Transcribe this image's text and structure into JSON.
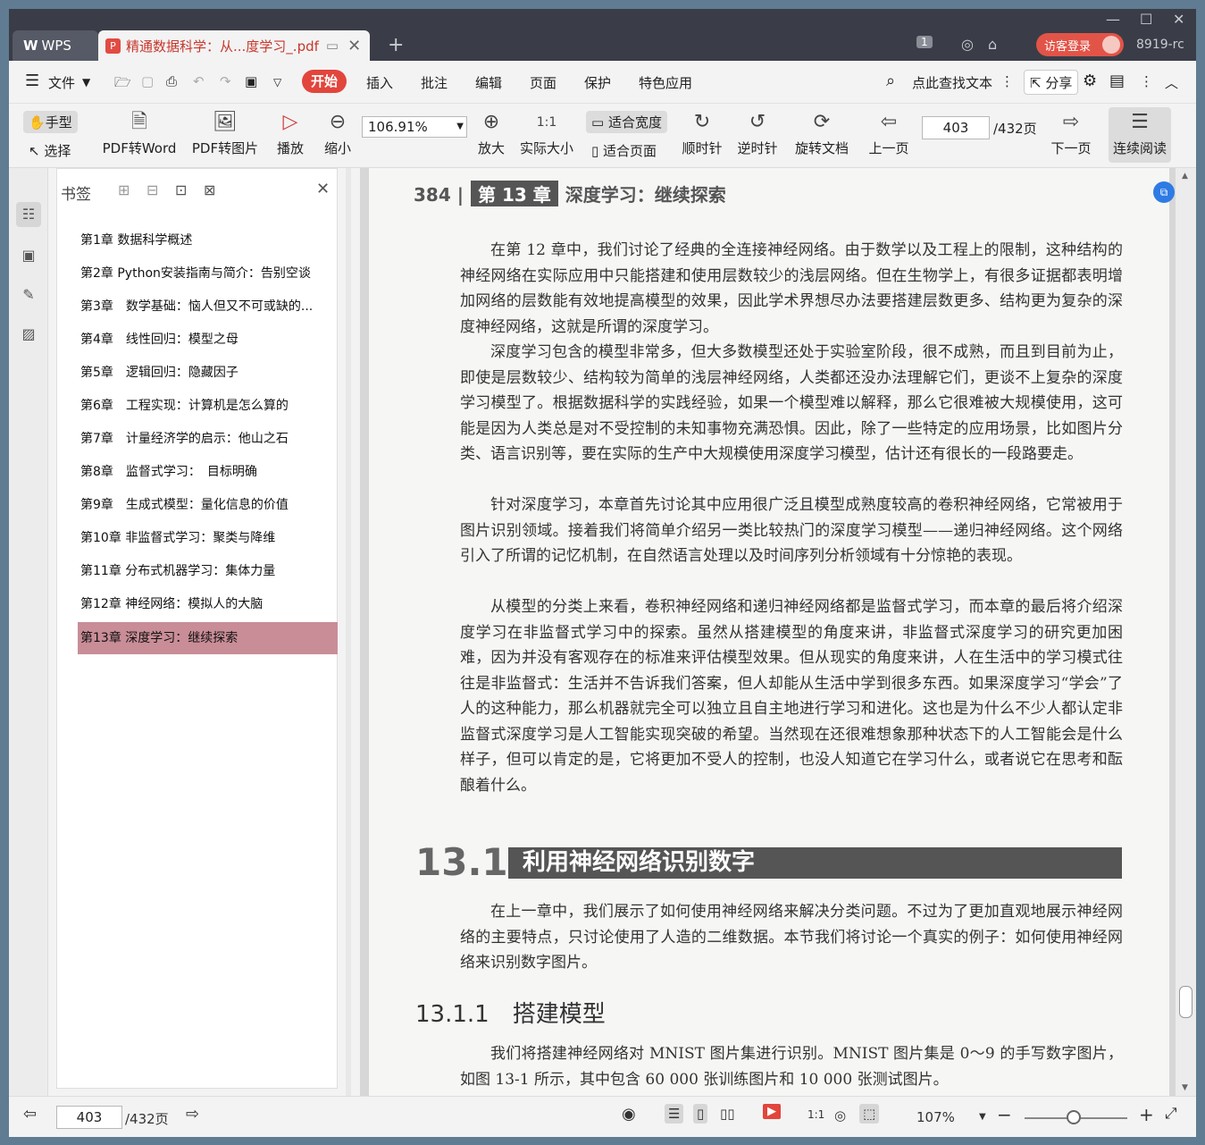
{
  "titlebar": {
    "app": "WPS",
    "doc_tab": "精通数据科学：从...度学习_.pdf",
    "tab_count": "1",
    "login": "访客登录",
    "version": "8919-rc"
  },
  "menu": {
    "file": "文件",
    "items": [
      "开始",
      "插入",
      "批注",
      "编辑",
      "页面",
      "保护",
      "特色应用"
    ],
    "search": "点此查找文本",
    "share": "分享"
  },
  "ribbon": {
    "hand": "手型",
    "select": "选择",
    "pdf_word": "PDF转Word",
    "pdf_image": "PDF转图片",
    "play": "播放",
    "zoom_out": "缩小",
    "zoom": "106.91%",
    "zoom_in": "放大",
    "actual": "实际大小",
    "fit_width": "适合宽度",
    "fit_page": "适合页面",
    "cw": "顺时针",
    "ccw": "逆时针",
    "rotate": "旋转文档",
    "prev": "上一页",
    "page": "403",
    "total": "/432页",
    "next": "下一页",
    "continuous": "连续阅读"
  },
  "bookmarks": {
    "title": "书签",
    "items": [
      "第1章 数据科学概述",
      "第2章 Python安装指南与简介：告别空谈",
      "第3章　数学基础：恼人但又不可或缺的...",
      "第4章　线性回归：模型之母",
      "第5章　逻辑回归：隐藏因子",
      "第6章　工程实现：计算机是怎么算的",
      "第7章　计量经济学的启示：他山之石",
      "第8章　监督式学习：　目标明确",
      "第9章　生成式模型：量化信息的价值",
      "第10章 非监督式学习：聚类与降维",
      "第11章 分布式机器学习：集体力量",
      "第12章 神经网络：模拟人的大脑",
      "第13章 深度学习：继续探索"
    ]
  },
  "pdf": {
    "page_no": "384",
    "chapter": "第 13 章",
    "chapter_title": "深度学习：继续探索",
    "paras": [
      "在第 12 章中，我们讨论了经典的全连接神经网络。由于数学以及工程上的限制，这种结构的神经网络在实际应用中只能搭建和使用层数较少的浅层网络。但在生物学上，有很多证据都表明增加网络的层数能有效地提高模型的效果，因此学术界想尽办法要搭建层数更多、结构更为复杂的深度神经网络，这就是所谓的深度学习。",
      "深度学习包含的模型非常多，但大多数模型还处于实验室阶段，很不成熟，而且到目前为止，即使是层数较少、结构较为简单的浅层神经网络，人类都还没办法理解它们，更谈不上复杂的深度学习模型了。根据数据科学的实践经验，如果一个模型难以解释，那么它很难被大规模使用，这可能是因为人类总是对不受控制的未知事物充满恐惧。因此，除了一些特定的应用场景，比如图片分类、语言识别等，要在实际的生产中大规模使用深度学习模型，估计还有很长的一段路要走。",
      "针对深度学习，本章首先讨论其中应用很广泛且模型成熟度较高的卷积神经网络，它常被用于图片识别领域。接着我们将简单介绍另一类比较热门的深度学习模型——递归神经网络。这个网络引入了所谓的记忆机制，在自然语言处理以及时间序列分析领域有十分惊艳的表现。",
      "从模型的分类上来看，卷积神经网络和递归神经网络都是监督式学习，而本章的最后将介绍深度学习在非监督式学习中的探索。虽然从搭建模型的角度来讲，非监督式深度学习的研究更加困难，因为并没有客观存在的标准来评估模型效果。但从现实的角度来讲，人在生活中的学习模式往往是非监督式：生活并不告诉我们答案，但人却能从生活中学到很多东西。如果深度学习“学会”了人的这种能力，那么机器就完全可以独立且自主地进行学习和进化。这也是为什么不少人都认定非监督式深度学习是人工智能实现突破的希望。当然现在还很难想象那种状态下的人工智能会是什么样子，但可以肯定的是，它将更加不受人的控制，也没人知道它在学习什么，或者说它在思考和酝酿着什么。"
    ],
    "sec_num": "13.1",
    "sec_title": "利用神经网络识别数字",
    "sec_para": "在上一章中，我们展示了如何使用神经网络来解决分类问题。不过为了更加直观地展示神经网络的主要特点，只讨论使用了人造的二维数据。本节我们将讨论一个真实的例子：如何使用神经网络来识别数字图片。",
    "sub_num": "13.1.1",
    "sub_title": "搭建模型",
    "sub_para": "我们将搭建神经网络对 MNIST 图片集进行识别。MNIST 图片集是 0～9 的手写数字图片，如图 13-1 所示，其中包含 60 000 张训练图片和 10 000 张测试图片。"
  },
  "status": {
    "page": "403",
    "total": "/432页",
    "zoom": "107%"
  }
}
